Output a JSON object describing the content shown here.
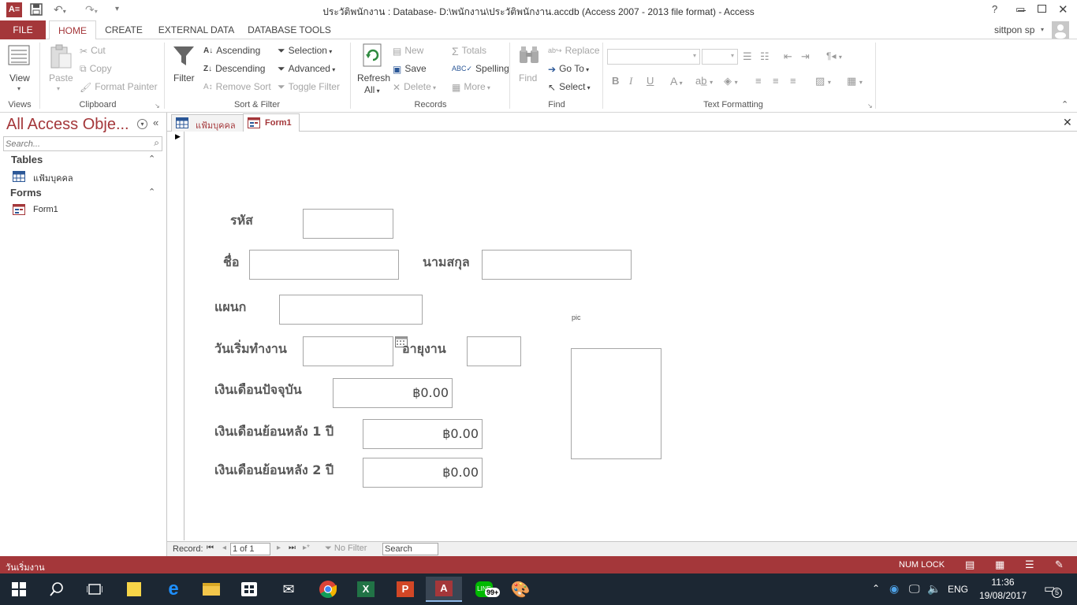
{
  "window": {
    "title": "ประวัติพนักงาน : Database- D:\\พนักงาน\\ประวัติพนักงาน.accdb (Access 2007 - 2013 file format) - Access",
    "user": "sittpon sp",
    "help": "?"
  },
  "ribbon_tabs": [
    "FILE",
    "HOME",
    "CREATE",
    "EXTERNAL DATA",
    "DATABASE TOOLS"
  ],
  "ribbon": {
    "views": {
      "label": "Views",
      "view": "View"
    },
    "clipboard": {
      "label": "Clipboard",
      "paste": "Paste",
      "cut": "Cut",
      "copy": "Copy",
      "format_painter": "Format Painter"
    },
    "sort_filter": {
      "label": "Sort & Filter",
      "filter": "Filter",
      "ascending": "Ascending",
      "descending": "Descending",
      "remove_sort": "Remove Sort",
      "selection": "Selection",
      "advanced": "Advanced",
      "toggle_filter": "Toggle Filter"
    },
    "records": {
      "label": "Records",
      "refresh": "Refresh",
      "refresh2": "All",
      "new": "New",
      "save": "Save",
      "delete": "Delete",
      "totals": "Totals",
      "spelling": "Spelling",
      "more": "More"
    },
    "find": {
      "label": "Find",
      "find": "Find",
      "replace": "Replace",
      "goto": "Go To",
      "select": "Select"
    },
    "text_formatting": {
      "label": "Text Formatting",
      "bold": "B",
      "italic": "I",
      "underline": "U",
      "font_color": "A"
    }
  },
  "nav": {
    "title": "All Access Obje...",
    "search_placeholder": "Search...",
    "sections": [
      {
        "name": "Tables",
        "items": [
          "แฟ้มบุคคล"
        ]
      },
      {
        "name": "Forms",
        "items": [
          "Form1"
        ]
      }
    ]
  },
  "doc_tabs": [
    {
      "label": "แฟ้มบุคคล",
      "active": false
    },
    {
      "label": "Form1",
      "active": true
    }
  ],
  "form": {
    "code_label": "รหัส",
    "name_label": "ชื่อ",
    "surname_label": "นามสกุล",
    "dept_label": "แผนก",
    "start_date_label": "วันเริ่มทำงาน",
    "tenure_label": "อายุงาน",
    "salary_label": "เงินเดือนปัจจุบัน",
    "salary_value": "฿0.00",
    "salary1_label": "เงินเดือนย้อนหลัง 1 ปี",
    "salary1_value": "฿0.00",
    "salary2_label": "เงินเดือนย้อนหลัง 2 ปี",
    "salary2_value": "฿0.00",
    "pic_label": "pic"
  },
  "record_nav": {
    "label": "Record:",
    "position": "1 of 1",
    "no_filter": "No Filter",
    "search": "Search"
  },
  "status": {
    "left": "วันเริ่มงาน",
    "num_lock": "NUM LOCK"
  },
  "taskbar": {
    "lang": "ENG",
    "time": "11:36",
    "date": "19/08/2017",
    "badge": "99+",
    "notif": "5"
  },
  "colors": {
    "accent": "#a4373a",
    "taskbar": "#1c2733"
  }
}
